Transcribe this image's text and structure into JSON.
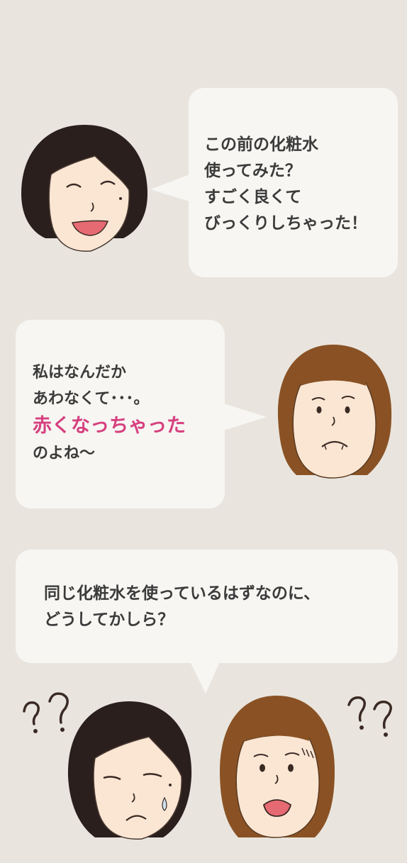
{
  "conversation": [
    {
      "speaker": "black-haired-woman",
      "expression": "smiling",
      "lines": [
        "この前の化粧水",
        "使ってみた？",
        "すごく良くて",
        "びっくりしちゃった！"
      ]
    },
    {
      "speaker": "brown-haired-woman",
      "expression": "worried",
      "lines": [
        "私はなんだか",
        "あわなくて･･･。"
      ],
      "highlight": "赤くなっちゃった",
      "tail_line": "のよね～",
      "highlight_color": "#d6407f"
    },
    {
      "speaker": "both",
      "expression": "puzzled",
      "lines": [
        "同じ化粧水を使っているはずなのに、",
        "どうしてかしら？"
      ]
    }
  ],
  "colors": {
    "background": "#e9e5de",
    "bubble": "#f7f6f3",
    "text": "#3b3b3b",
    "black_hair": "#2a1f1c",
    "brown_hair": "#8a5224",
    "skin": "#fbe6d3"
  }
}
